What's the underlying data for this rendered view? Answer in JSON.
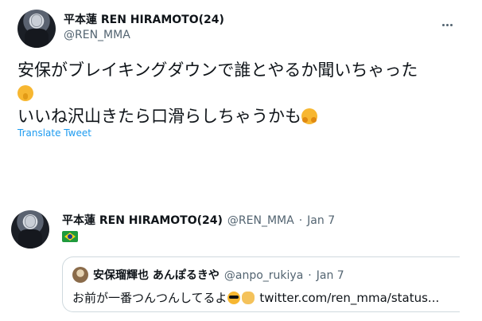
{
  "tweet1": {
    "author_name": "平本蓮 REN HIRAMOTO(24)",
    "author_handle": "@REN_MMA",
    "text_line1": "安保がブレイキングダウンで誰とやるか聞いちゃった",
    "text_line2": "いいね沢山きたら口滑らしちゃうかも",
    "emoji_line1": "shushing-face-icon",
    "emoji_line2": "hugging-face-icon",
    "translate_label": "Translate Tweet"
  },
  "tweet2": {
    "author_name": "平本蓮 REN HIRAMOTO(24)",
    "author_handle": "@REN_MMA",
    "separator": "·",
    "date": "Jan 7",
    "flag": "brazil-flag-icon",
    "quote": {
      "author_name": "安保瑠輝也 あんぽるきや",
      "author_handle": "@anpo_rukiya",
      "separator": "·",
      "date": "Jan 7",
      "text": "お前が一番つんつんしてるよ",
      "link": "twitter.com/ren_mma/status..."
    }
  },
  "colors": {
    "text": "#0f1419",
    "muted": "#536471",
    "link": "#1d9bf0",
    "border": "#cfd9de"
  }
}
